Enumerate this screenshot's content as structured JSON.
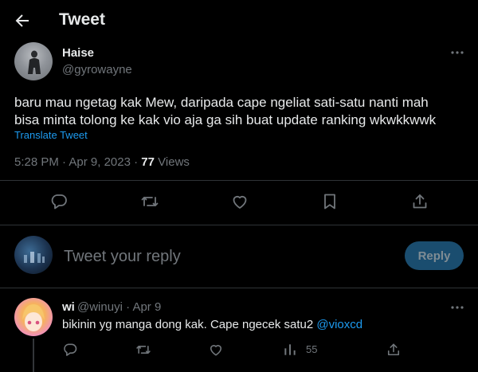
{
  "header": {
    "title": "Tweet"
  },
  "tweet": {
    "author_name": "Haise",
    "author_handle": "@gyrowayne",
    "text": "baru mau ngetag kak Mew, daripada cape ngeliat sati-satu nanti mah\nbisa minta tolong ke kak vio aja ga sih buat update ranking wkwkkwwk",
    "translate_label": "Translate Tweet",
    "time": "5:28 PM",
    "date": "Apr 9, 2023",
    "views_count": "77",
    "views_label": "Views"
  },
  "reply_box": {
    "placeholder": "Tweet your reply",
    "button_label": "Reply"
  },
  "reply": {
    "author_name": "wi",
    "author_handle": "@winuyi",
    "date": "Apr 9",
    "text": "bikinin yg manga dong kak. Cape ngecek satu2 ",
    "mention": "@vioxcd",
    "views_count": "55"
  },
  "colors": {
    "accent": "#1d9bf0",
    "muted": "#71767b",
    "text": "#e7e9ea",
    "background": "#000000",
    "divider": "#2f3336"
  },
  "icons": [
    "back-arrow-icon",
    "more-icon",
    "reply-icon",
    "retweet-icon",
    "like-icon",
    "bookmark-icon",
    "share-icon",
    "views-icon"
  ]
}
